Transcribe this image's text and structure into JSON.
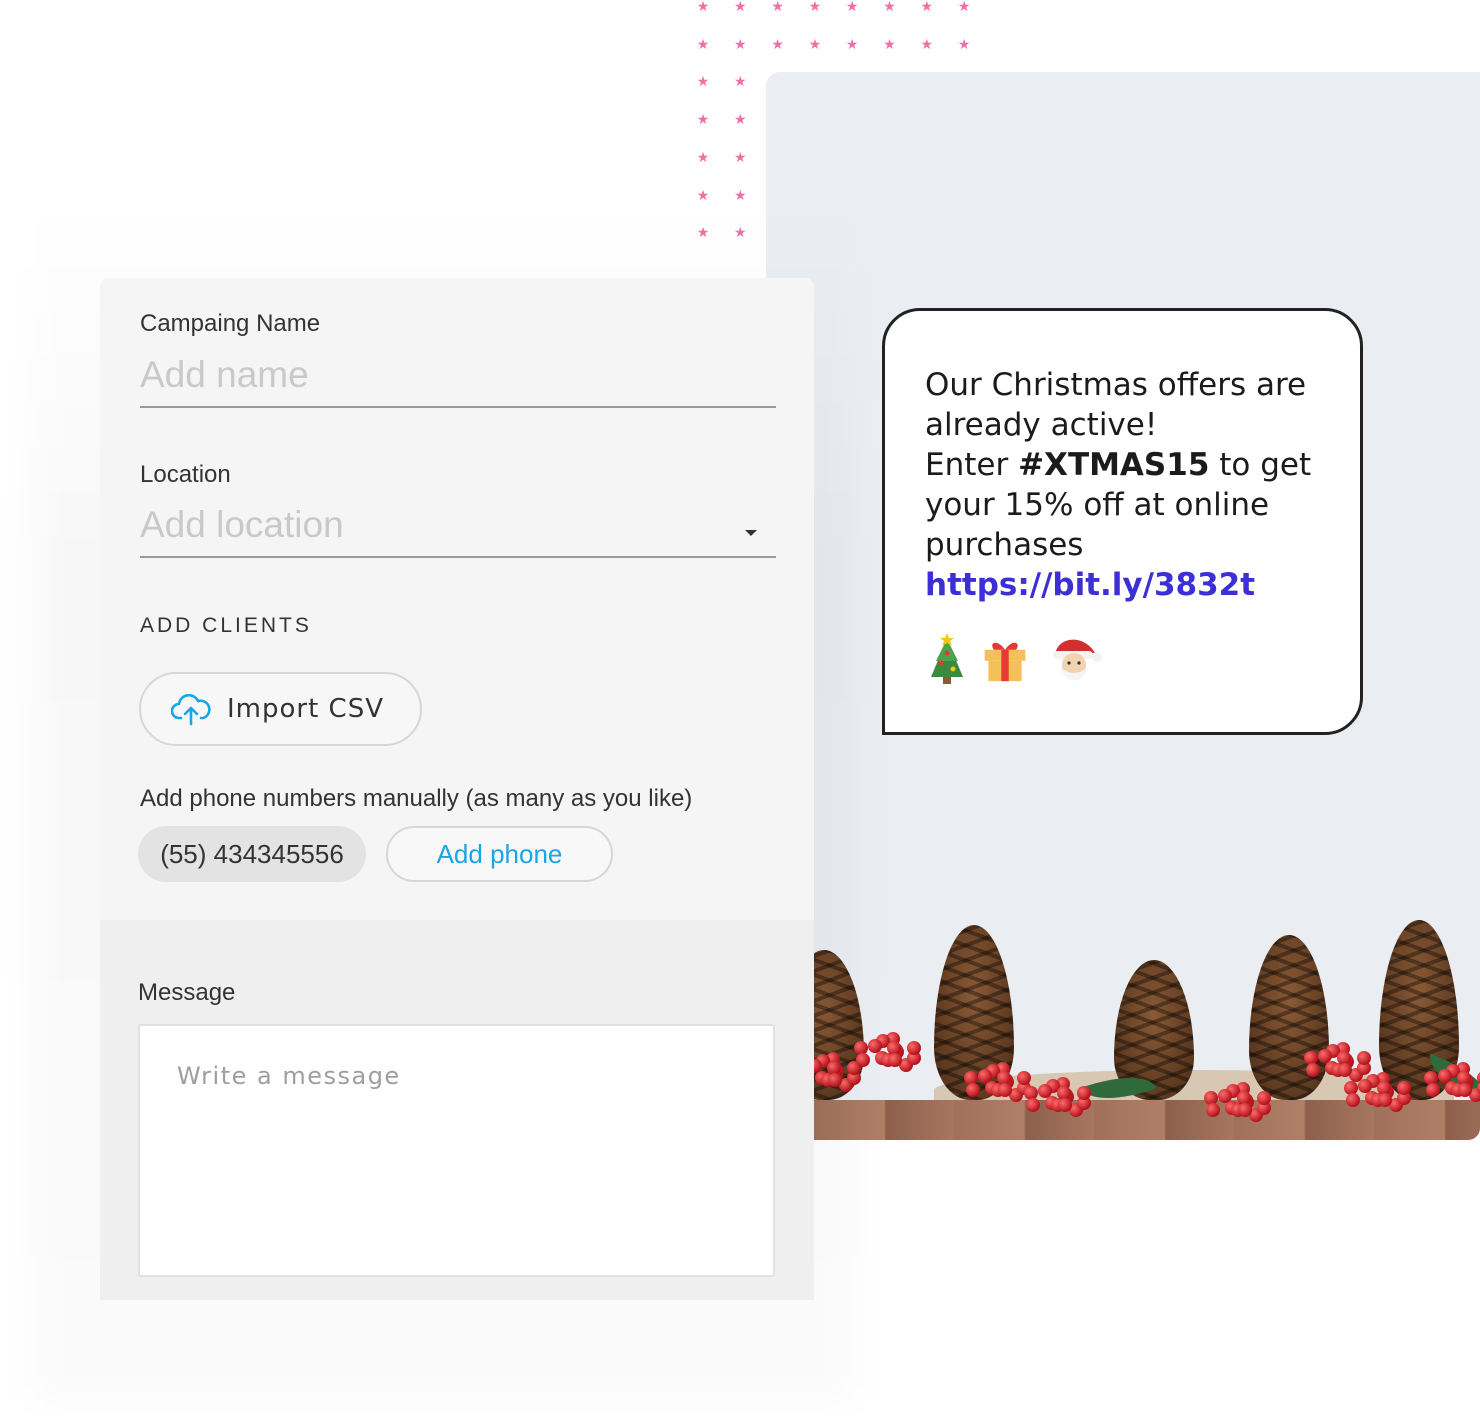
{
  "form": {
    "campaign_name_label": "Campaing Name",
    "campaign_name_placeholder": "Add name",
    "location_label": "Location",
    "location_placeholder": "Add location",
    "add_clients_title": "ADD CLIENTS",
    "import_csv_label": "Import CSV",
    "phones_hint": "Add phone numbers manually (as many as you like)",
    "phone_chip": "(55) 434345556",
    "add_phone_label": "Add phone",
    "message_label": "Message",
    "message_placeholder": "Write a message"
  },
  "preview": {
    "line1": "Our Christmas offers are",
    "line2": "already active!",
    "line3_prefix": "Enter ",
    "promo_code": "#XTMAS15",
    "line3_suffix": " to get",
    "line4": "your 15% off at online",
    "line5": "purchases",
    "link": "https://bit.ly/3832t",
    "emojis": [
      "christmas-tree-icon",
      "gift-icon",
      "santa-icon"
    ]
  },
  "colors": {
    "accent_blue": "#1aa5e6",
    "link_purple": "#3d2fd6",
    "star_pink": "#f06fa7",
    "panel_grey": "#eaedf1"
  }
}
